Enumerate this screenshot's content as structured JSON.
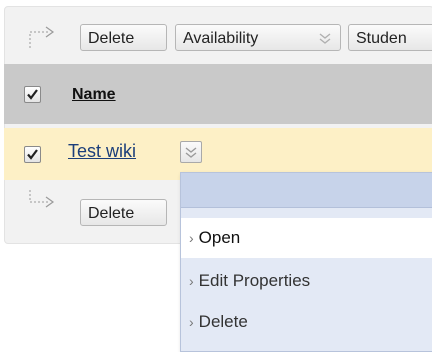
{
  "toolbar_top": {
    "delete_label": "Delete",
    "availability_label": "Availability",
    "students_label": "Studen"
  },
  "table": {
    "header": {
      "name_label": "Name",
      "select_all_checked": true
    },
    "rows": [
      {
        "title": "Test wiki",
        "checked": true
      }
    ]
  },
  "toolbar_bottom": {
    "delete_label": "Delete"
  },
  "context_menu": {
    "items": [
      {
        "label": "Open",
        "active": true
      },
      {
        "label": "Edit Properties",
        "active": false
      },
      {
        "label": "Delete",
        "active": false
      }
    ]
  },
  "colors": {
    "header_bg": "#c9c9c9",
    "selected_row_bg": "#fdf0c6",
    "menu_bg": "#e3e9f5",
    "menu_header_bg": "#c7d3ea",
    "link": "#1b3e7a"
  }
}
